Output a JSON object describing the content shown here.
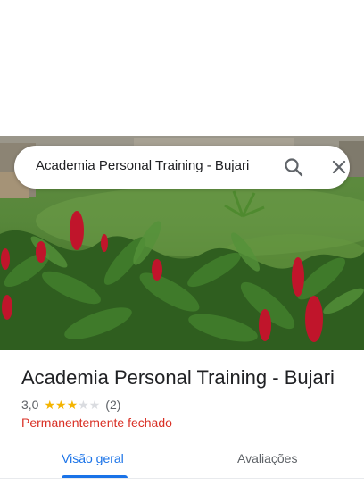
{
  "search": {
    "query": "Academia Personal Training - Bujari",
    "search_icon": "search-icon",
    "close_icon": "close-icon"
  },
  "hero": {
    "photo_icon": "garden-photo"
  },
  "place": {
    "title": "Academia Personal Training - Bujari",
    "rating": "3,0",
    "stars_filled": 3,
    "stars_total": 5,
    "review_count": "(2)",
    "status": "Permanentemente fechado",
    "status_color": "#d93025"
  },
  "tabs": [
    {
      "label": "Visão geral",
      "active": true
    },
    {
      "label": "Avaliações",
      "active": false
    }
  ],
  "colors": {
    "accent": "#1a73e8",
    "star": "#f4b400",
    "star_empty": "#dadce0"
  }
}
